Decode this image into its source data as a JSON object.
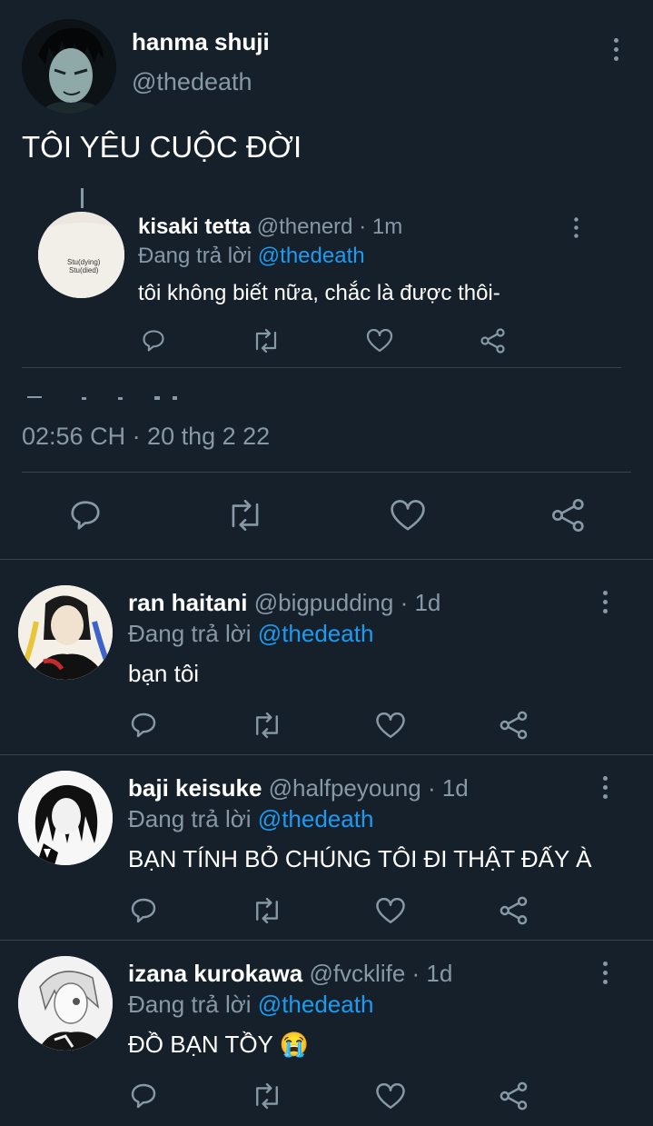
{
  "main_tweet": {
    "display_name": "hanma shuji",
    "handle": "@thedeath",
    "text": "TÔI YÊU CUỘC ĐỜI",
    "timestamp": "02:56 CH · 20 thg 2 22"
  },
  "quoted_reply": {
    "display_name": "kisaki tetta",
    "handle": "@thenerd",
    "time": "· 1m",
    "replying_prefix": "Đang trả lời",
    "replying_to": "@thedeath",
    "text": "tôi không biết nữa, chắc là được thôi-",
    "avatar_text": "Stu(dying)\nStu(died)"
  },
  "replies": [
    {
      "display_name": "ran haitani",
      "handle": "@bigpudding",
      "time": "· 1d",
      "replying_prefix": "Đang trả lời",
      "replying_to": "@thedeath",
      "text": "bạn tôi"
    },
    {
      "display_name": "baji keisuke",
      "handle": "@halfpeyoung",
      "time": "· 1d",
      "replying_prefix": "Đang trả lời",
      "replying_to": "@thedeath",
      "text": "BẠN TÍNH BỎ CHÚNG TÔI ĐI THẬT ĐẤY À"
    },
    {
      "display_name": "izana kurokawa",
      "handle": "@fvcklife",
      "time": "· 1d",
      "replying_prefix": "Đang trả lời",
      "replying_to": "@thedeath",
      "text": "ĐỒ BẠN TỒY 😭"
    }
  ],
  "icons": [
    "reply-icon",
    "retweet-icon",
    "like-icon",
    "share-icon",
    "more-icon"
  ],
  "colors": {
    "background": "#15202b",
    "divider": "#38444d",
    "secondary_text": "#8899a6",
    "link": "#1d9bf0"
  }
}
